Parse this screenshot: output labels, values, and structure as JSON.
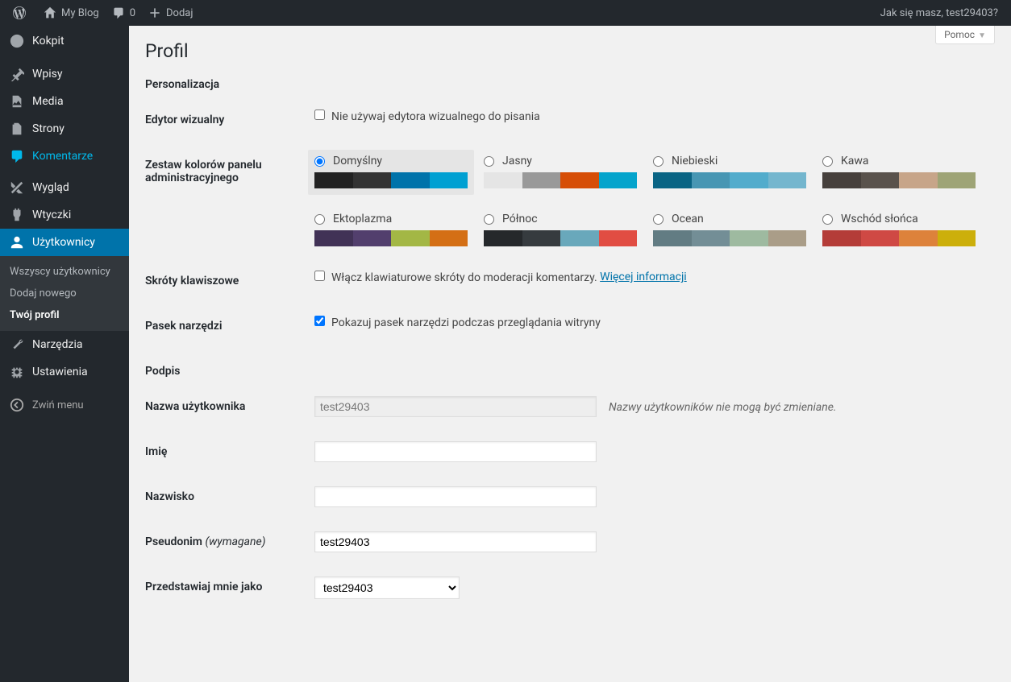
{
  "adminbar": {
    "site_name": "My Blog",
    "comments_count": "0",
    "new_label": "Dodaj",
    "howdy": "Jak się masz, test29403?"
  },
  "help": {
    "label": "Pomoc"
  },
  "menu": {
    "dashboard": "Kokpit",
    "posts": "Wpisy",
    "media": "Media",
    "pages": "Strony",
    "comments": "Komentarze",
    "appearance": "Wygląd",
    "plugins": "Wtyczki",
    "users": "Użytkownicy",
    "tools": "Narzędzia",
    "settings": "Ustawienia",
    "collapse": "Zwiń menu",
    "users_sub": {
      "all": "Wszyscy użytkownicy",
      "add": "Dodaj nowego",
      "profile": "Twój profil"
    }
  },
  "page": {
    "title": "Profil",
    "section_personal": "Personalizacja",
    "section_name": "Podpis"
  },
  "fields": {
    "visual_editor": {
      "label": "Edytor wizualny",
      "checkbox": "Nie używaj edytora wizualnego do pisania"
    },
    "color_scheme": {
      "label": "Zestaw kolorów panelu administracyjnego"
    },
    "shortcuts": {
      "label": "Skróty klawiszowe",
      "checkbox": "Włącz klawiaturowe skróty do moderacji komentarzy.",
      "more": "Więcej informacji"
    },
    "toolbar": {
      "label": "Pasek narzędzi",
      "checkbox": "Pokazuj pasek narzędzi podczas przeglądania witryny"
    },
    "username": {
      "label": "Nazwa użytkownika",
      "value": "test29403",
      "note": "Nazwy użytkowników nie mogą być zmieniane."
    },
    "first_name": {
      "label": "Imię",
      "value": ""
    },
    "last_name": {
      "label": "Nazwisko",
      "value": ""
    },
    "nickname": {
      "label": "Pseudonim",
      "req": "(wymagane)",
      "value": "test29403"
    },
    "display_name": {
      "label": "Przedstawiaj mnie jako",
      "value": "test29403"
    }
  },
  "color_schemes": [
    {
      "name": "Domyślny",
      "selected": true,
      "colors": [
        "#222222",
        "#333333",
        "#0073aa",
        "#00a0d2"
      ]
    },
    {
      "name": "Jasny",
      "selected": false,
      "colors": [
        "#e5e5e5",
        "#999999",
        "#d64e07",
        "#04a4cc"
      ]
    },
    {
      "name": "Niebieski",
      "selected": false,
      "colors": [
        "#096484",
        "#4796b3",
        "#52accc",
        "#74B6CE"
      ]
    },
    {
      "name": "Kawa",
      "selected": false,
      "colors": [
        "#46403c",
        "#59524c",
        "#c7a589",
        "#9ea476"
      ]
    },
    {
      "name": "Ektoplazma",
      "selected": false,
      "colors": [
        "#413256",
        "#523f6d",
        "#a3b745",
        "#d46f15"
      ]
    },
    {
      "name": "Północ",
      "selected": false,
      "colors": [
        "#25282b",
        "#363b3f",
        "#69a8bb",
        "#e14d43"
      ]
    },
    {
      "name": "Ocean",
      "selected": false,
      "colors": [
        "#627c83",
        "#738e96",
        "#9ebaa0",
        "#aa9d88"
      ]
    },
    {
      "name": "Wschód słońca",
      "selected": false,
      "colors": [
        "#b43c38",
        "#cf4944",
        "#dd823b",
        "#ccaf0b"
      ]
    }
  ]
}
